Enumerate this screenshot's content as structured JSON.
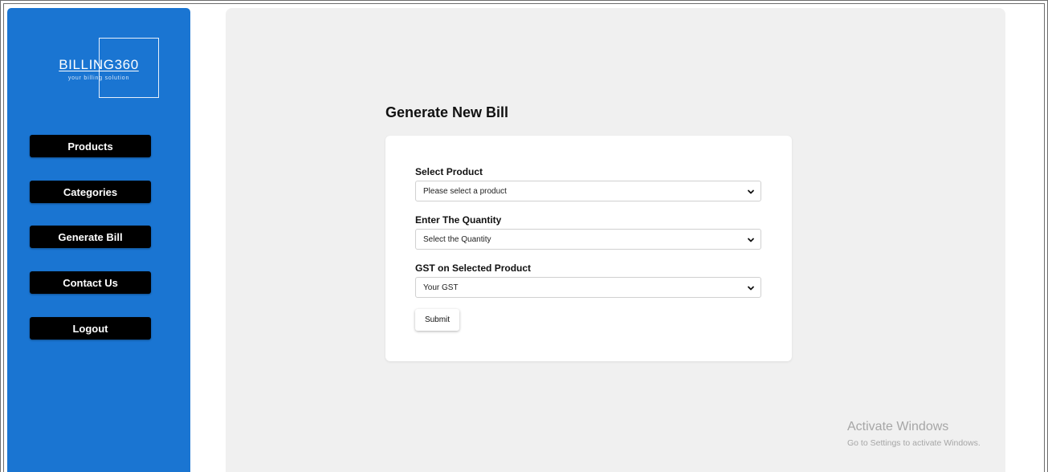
{
  "brand": {
    "title": "BILLING360",
    "tagline": "your billing solution"
  },
  "sidebar": {
    "items": [
      {
        "label": "Products"
      },
      {
        "label": "Categories"
      },
      {
        "label": "Generate Bill"
      },
      {
        "label": "Contact Us"
      },
      {
        "label": "Logout"
      }
    ]
  },
  "main": {
    "title": "Generate New Bill",
    "fields": [
      {
        "label": "Select Product",
        "value": "Please select a product"
      },
      {
        "label": "Enter The Quantity",
        "value": "Select the Quantity"
      },
      {
        "label": "GST on Selected Product",
        "value": "Your GST"
      }
    ],
    "submit_label": "Submit"
  },
  "watermark": {
    "title": "Activate Windows",
    "subtitle": "Go to Settings to activate Windows."
  },
  "colors": {
    "sidebar": "#1a75d2",
    "nav_button": "#000000",
    "content_bg": "#f0f0f0",
    "card": "#ffffff"
  },
  "icons": {
    "select_indicator": "chevron-down-icon"
  }
}
